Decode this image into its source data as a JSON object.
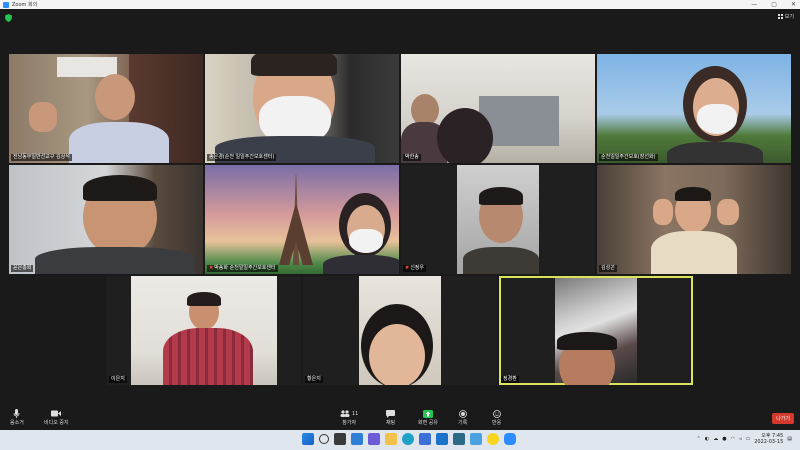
{
  "window": {
    "title": "Zoom 회의",
    "buttons": [
      "—",
      "▢",
      "✕"
    ]
  },
  "view_button": {
    "label": "보기"
  },
  "participants": [
    {
      "name": "전남동부일반선교구 김상석",
      "muted": false
    },
    {
      "name": "송은경(순천 일일주간보호센터)",
      "muted": false
    },
    {
      "name": "박한송",
      "muted": false
    },
    {
      "name": "순천일일주간보호(장선화)",
      "muted": false
    },
    {
      "name": "윤은총회",
      "muted": false
    },
    {
      "name": "박송화 순천일일주간보호센터",
      "muted": true
    },
    {
      "name": "신정우",
      "muted": true
    },
    {
      "name": "김성곤",
      "muted": false
    },
    {
      "name": "이은지",
      "muted": false
    },
    {
      "name": "황은지",
      "muted": false
    },
    {
      "name": "정경환",
      "muted": false,
      "active": true
    }
  ],
  "toolbar": {
    "mute": "음소거",
    "video": "비디오 중지",
    "participants": "참가자",
    "participants_count": "11",
    "chat": "채팅",
    "share": "화면 공유",
    "record": "기록",
    "reactions": "반응",
    "leave": "나가기"
  },
  "taskbar": {
    "time": "오후 7:45",
    "date": "2022-03-15"
  },
  "colors": {
    "accent": "#2d8cff",
    "leave": "#d33a2c",
    "active_speaker": "#d9e35b",
    "share": "#23c552"
  }
}
